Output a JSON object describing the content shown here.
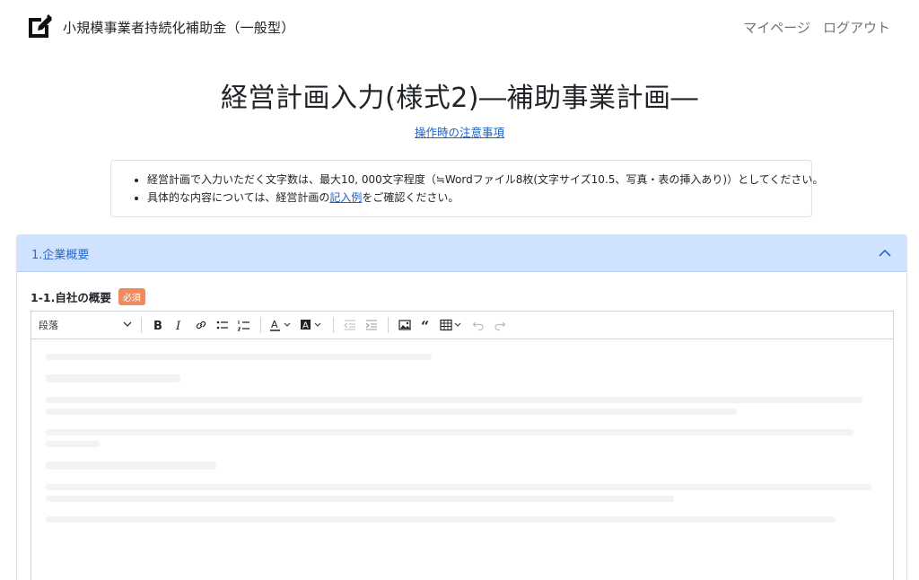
{
  "header": {
    "app_title": "小規模事業者持続化補助金（一般型）",
    "nav": [
      "マイページ",
      "ログアウト"
    ]
  },
  "page": {
    "title": "経営計画入力(様式2)―補助事業計画―",
    "notes_link": "操作時の注意事項"
  },
  "notice": {
    "item1": "経営計画で入力いただく文字数は、最大10, 000文字程度（≒Wordファイル8枚(文字サイズ10.5、写真・表の挿入あり)）としてください。",
    "item2_before": "具体的な内容については、経営計画の",
    "item2_link": "記入例",
    "item2_after": "をご確認ください。"
  },
  "section": {
    "title": "1.企業概要",
    "expanded": true
  },
  "field": {
    "label": "1-1.自社の概要",
    "required_badge": "必須"
  },
  "editor": {
    "paragraph_style": "段落",
    "toolbar_icons": [
      "bold-icon",
      "italic-icon",
      "link-icon",
      "bulleted-list-icon",
      "numbered-list-icon",
      "font-color-icon",
      "background-color-icon",
      "outdent-icon",
      "indent-icon",
      "image-icon",
      "blockquote-icon",
      "table-icon",
      "undo-icon",
      "redo-icon"
    ]
  },
  "colors": {
    "accent": "#1a62c9",
    "section_header_bg": "#cfe2ff",
    "required_badge": "#f08a5d"
  }
}
